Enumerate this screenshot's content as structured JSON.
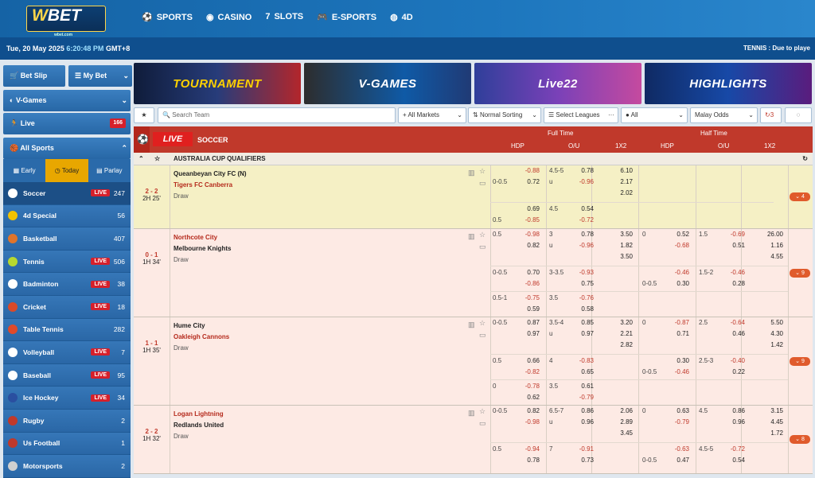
{
  "brand": {
    "logo_w": "W",
    "logo_rest": "BET",
    "logo_sub": "wbet.com"
  },
  "nav": [
    {
      "icon": "⚽",
      "label": "SPORTS"
    },
    {
      "icon": "◉",
      "label": "CASINO"
    },
    {
      "icon": "7",
      "label": "SLOTS"
    },
    {
      "icon": "🎮",
      "label": "E-SPORTS"
    },
    {
      "icon": "◍",
      "label": "4D"
    }
  ],
  "subbar": {
    "date": "Tue, 20 May 2025",
    "time": "6:20:48 PM",
    "tz": "GMT+8",
    "ticker": "TENNIS : Due to playe"
  },
  "side": {
    "betslip": "Bet Slip",
    "mybet": "My Bet",
    "vgames": "V-Games",
    "live": "Live",
    "live_count": "166",
    "allsports": "All Sports",
    "tabs": [
      "Early",
      "Today",
      "Parlay"
    ],
    "sports": [
      {
        "name": "Soccer",
        "live": "LIVE",
        "count": "247",
        "color": "#ffffff"
      },
      {
        "name": "4d Special",
        "live": "",
        "count": "56",
        "color": "#f2c200"
      },
      {
        "name": "Basketball",
        "live": "",
        "count": "407",
        "color": "#e0742a"
      },
      {
        "name": "Tennis",
        "live": "LIVE",
        "count": "506",
        "color": "#b6d930"
      },
      {
        "name": "Badminton",
        "live": "LIVE",
        "count": "38",
        "color": "#ffffff"
      },
      {
        "name": "Cricket",
        "live": "LIVE",
        "count": "18",
        "color": "#d94a2a"
      },
      {
        "name": "Table Tennis",
        "live": "",
        "count": "282",
        "color": "#e04a2a"
      },
      {
        "name": "Volleyball",
        "live": "LIVE",
        "count": "7",
        "color": "#ffffff"
      },
      {
        "name": "Baseball",
        "live": "LIVE",
        "count": "95",
        "color": "#ffffff"
      },
      {
        "name": "Ice Hockey",
        "live": "LIVE",
        "count": "34",
        "color": "#2a4fa0"
      },
      {
        "name": "Rugby",
        "live": "",
        "count": "2",
        "color": "#c0392b"
      },
      {
        "name": "Us Football",
        "live": "",
        "count": "1",
        "color": "#c0392b"
      },
      {
        "name": "Motorsports",
        "live": "",
        "count": "2",
        "color": "#d0d0d0"
      }
    ]
  },
  "banners": [
    "TOURNAMENT",
    "V-GAMES",
    "Live22",
    "HIGHLIGHTS"
  ],
  "filters": {
    "search_placeholder": "Search Team",
    "markets": "+ All Markets",
    "sorting": "Normal Sorting",
    "leagues": "Select Leagues",
    "all": "All",
    "odds": "Malay Odds",
    "refresh": "3"
  },
  "grid": {
    "live": "LIVE",
    "sport": "SOCCER",
    "full": "Full Time",
    "half": "Half Time",
    "hdp": "HDP",
    "ou": "O/U",
    "x12": "1X2",
    "competition": "AUSTRALIA CUP QUALIFIERS"
  },
  "matches": [
    {
      "home": "Queanbeyan City FC (N)",
      "away": "Tigers FC Canberra",
      "draw": "Draw",
      "score": "2 - 2",
      "time": "2H 25'",
      "more": "4"
    },
    {
      "home": "Northcote City",
      "away": "Melbourne Knights",
      "draw": "Draw",
      "score": "0 - 1",
      "time": "1H 34'",
      "more": "9"
    },
    {
      "home": "Hume City",
      "away": "Oakleigh Cannons",
      "draw": "Draw",
      "score": "1 - 1",
      "time": "1H 35'",
      "more": "9"
    },
    {
      "home": "Logan Lightning",
      "away": "Redlands United",
      "draw": "Draw",
      "score": "2 - 2",
      "time": "1H 32'",
      "more": "8"
    }
  ],
  "odds": {
    "m1": [
      "0-0.5",
      "-0.88",
      "0.72",
      "4.5-5",
      "u",
      "0.78",
      "-0.96",
      "6.10",
      "2.17",
      "2.02",
      "0.69",
      "-0.85",
      "0.5",
      "4.5",
      "0.54",
      "-0.72"
    ],
    "m2": [
      "0.5",
      "-0.98",
      "0.82",
      "3",
      "u",
      "0.78",
      "-0.96",
      "3.50",
      "1.82",
      "3.50",
      "0",
      "0.52",
      "-0.68",
      "1.5",
      "-0.69",
      "0.51",
      "26.00",
      "1.16",
      "4.55",
      "0-0.5",
      "0.70",
      "-0.86",
      "3-3.5",
      "-0.93",
      "0.75",
      "0-0.5",
      "-0.46",
      "0.30",
      "1.5-2",
      "-0.46",
      "0.28",
      "0.5-1",
      "-0.75",
      "0.59",
      "3.5",
      "-0.76",
      "0.58"
    ],
    "m3": [
      "0-0.5",
      "0.87",
      "0.97",
      "3.5-4",
      "u",
      "0.85",
      "0.97",
      "3.20",
      "2.21",
      "2.82",
      "0",
      "-0.87",
      "0.71",
      "2.5",
      "-0.64",
      "0.46",
      "5.50",
      "4.30",
      "1.42",
      "0.5",
      "0.66",
      "-0.82",
      "4",
      "-0.83",
      "0.65",
      "0-0.5",
      "0.30",
      "-0.46",
      "2.5-3",
      "-0.40",
      "0.22",
      "0",
      "-0.78",
      "0.62",
      "3.5",
      "0.61",
      "-0.79"
    ],
    "m4": [
      "0-0.5",
      "0.82",
      "-0.98",
      "6.5-7",
      "u",
      "0.86",
      "0.96",
      "2.06",
      "2.89",
      "3.45",
      "0",
      "0.63",
      "-0.79",
      "4.5",
      "0.86",
      "0.96",
      "3.15",
      "4.45",
      "1.72",
      "0.5",
      "-0.94",
      "0.78",
      "7",
      "-0.91",
      "0.73",
      "0-0.5",
      "-0.63",
      "0.47",
      "4.5-5",
      "-0.72",
      "0.54"
    ]
  },
  "colors": {
    "accent": "#c0392b",
    "nav": "#1563a5",
    "side": "#2a67a6"
  }
}
